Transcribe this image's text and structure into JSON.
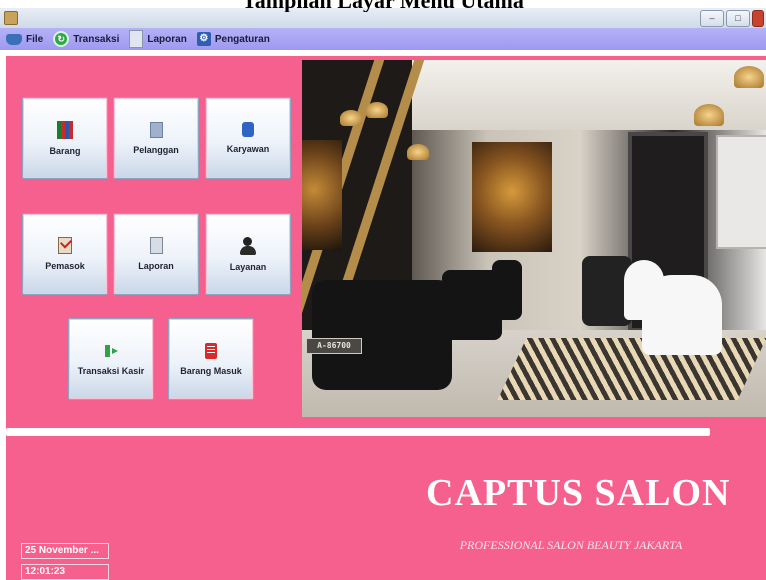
{
  "caption": "Tampilan Layar Menu Utama",
  "window": {
    "controls": [
      "–",
      "□",
      ""
    ]
  },
  "menu": [
    {
      "label": "File",
      "icon": "folder-icon"
    },
    {
      "label": "Transaksi",
      "icon": "refresh-icon"
    },
    {
      "label": "Laporan",
      "icon": "document-icon"
    },
    {
      "label": "Pengaturan",
      "icon": "gear-icon"
    }
  ],
  "buttons": {
    "barang": "Barang",
    "pelanggan": "Pelanggan",
    "karyawan": "Karyawan",
    "pemasok": "Pemasok",
    "laporan": "Laporan",
    "layanan": "Layanan",
    "transaksi_kasir": "Transaksi Kasir",
    "barang_masuk": "Barang Masuk"
  },
  "hero": {
    "plate_text": "A-86700"
  },
  "brand": {
    "name": "CAPTUS SALON",
    "tagline": "PROFESSIONAL SALON BEAUTY JAKARTA"
  },
  "status": {
    "date": "25 November ...",
    "time": "12:01:23"
  },
  "colors": {
    "background_pink": "#f6608f",
    "menubar": "#a9a6f4"
  }
}
